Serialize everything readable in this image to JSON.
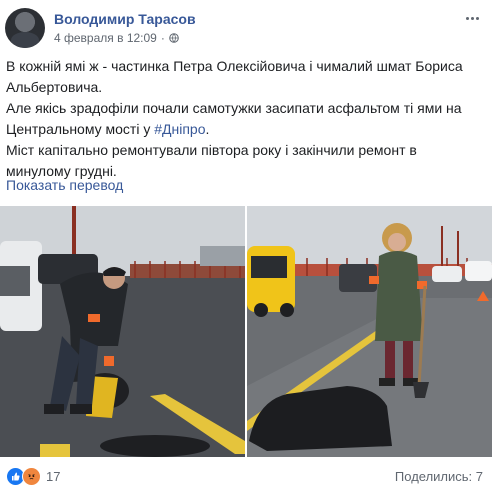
{
  "post": {
    "author": "Володимир Тарасов",
    "date": "4 февраля в 12:09",
    "text_line1": "В кожній ямі ж - частинка Петра Олексійовича і чималий шмат Бориса Альбертовича.",
    "text_line2_pre": "Але якісь зрадофіли почали самотужки засипати асфальтом ті ями на Центральному мості у ",
    "hashtag": "#Дніпро",
    "text_line2_post": ".",
    "text_line3": "Міст капітально ремонтували півтора року і закінчили ремонт в минулому грудні.",
    "translate_link": "Показать перевод"
  },
  "footer": {
    "reaction_count": "17",
    "shares": "Поделились: 7"
  },
  "icons": {
    "privacy": "globe-icon",
    "menu": "more-options-icon",
    "reaction1": "like-icon",
    "reaction2": "angry-icon"
  },
  "colors": {
    "link": "#385898",
    "like": "#1877f2",
    "angry": "#f0863e"
  }
}
